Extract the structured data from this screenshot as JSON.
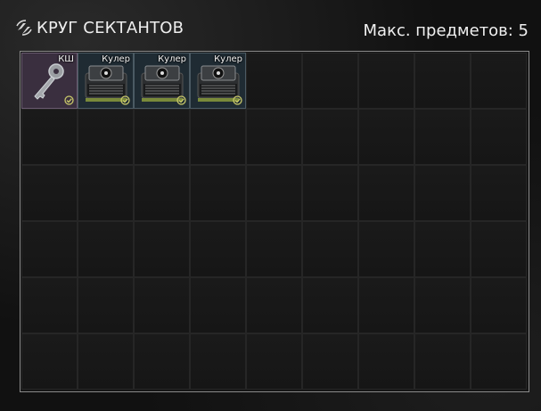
{
  "header": {
    "title": "КРУГ СЕКТАНТОВ",
    "max_items": "Макс. предметов: 5"
  },
  "grid": {
    "columns": 9,
    "rows": 6
  },
  "items": [
    {
      "label": "КШ",
      "kind": "key",
      "icon": "key-icon",
      "found_in_raid": true
    },
    {
      "label": "Кулер",
      "kind": "cooler",
      "icon": "cpu-cooler-icon",
      "found_in_raid": true
    },
    {
      "label": "Кулер",
      "kind": "cooler",
      "icon": "cpu-cooler-icon",
      "found_in_raid": true
    },
    {
      "label": "Кулер",
      "kind": "cooler",
      "icon": "cpu-cooler-icon",
      "found_in_raid": true
    }
  ],
  "colors": {
    "key_bg": "#3a2f3f",
    "cooler_bg": "#1f2b33",
    "check": "#c8c86a"
  }
}
